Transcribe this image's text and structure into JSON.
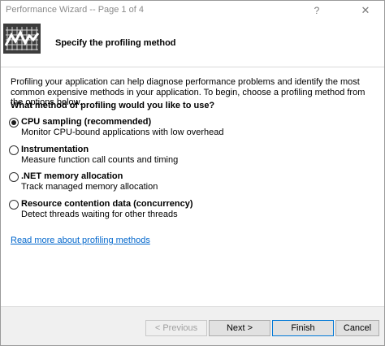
{
  "window": {
    "title": "Performance Wizard -- Page 1 of 4",
    "help": "?",
    "close": "✕"
  },
  "header": {
    "title": "Specify the profiling method"
  },
  "content": {
    "intro": "Profiling your application can help diagnose performance problems and identify the most common expensive methods in your application. To begin, choose a profiling method from the options below.",
    "question": "What method of profiling would you like to use?",
    "options": [
      {
        "label": "CPU sampling (recommended)",
        "desc": "Monitor CPU-bound applications with low overhead",
        "checked": true
      },
      {
        "label": "Instrumentation",
        "desc": "Measure function call counts and timing",
        "checked": false
      },
      {
        "label": ".NET memory allocation",
        "desc": "Track managed memory allocation",
        "checked": false
      },
      {
        "label": "Resource contention data (concurrency)",
        "desc": "Detect threads waiting for other threads",
        "checked": false
      }
    ],
    "link": "Read more about profiling methods"
  },
  "footer": {
    "previous": "< Previous",
    "next": "Next >",
    "finish": "Finish",
    "cancel": "Cancel"
  }
}
